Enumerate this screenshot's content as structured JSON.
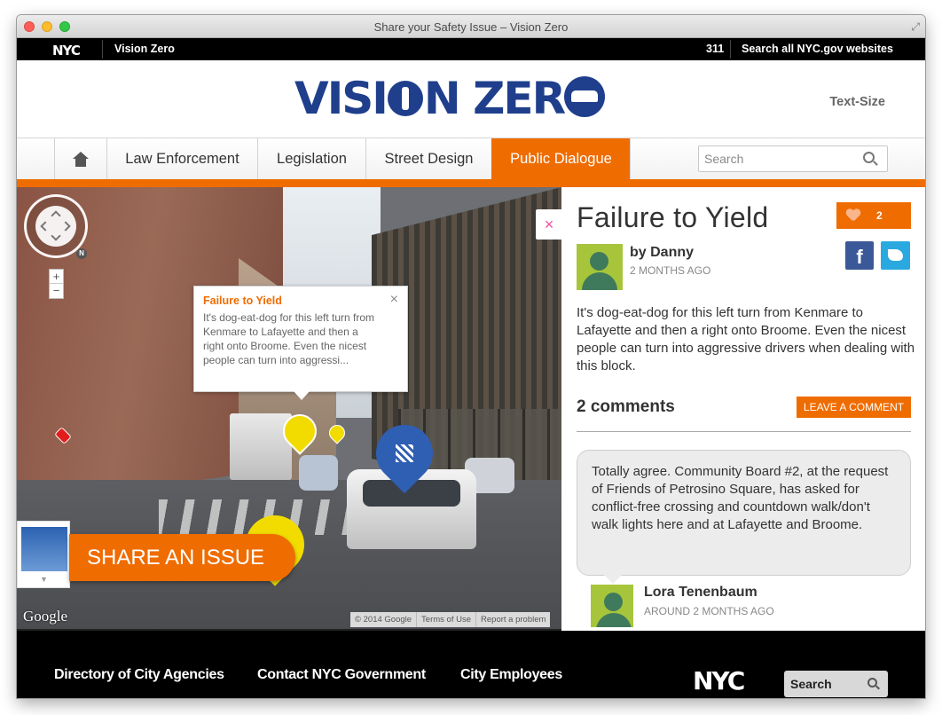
{
  "window": {
    "title": "Share your Safety Issue – Vision Zero"
  },
  "nyc_bar": {
    "logo": "NYC",
    "site": "Vision Zero",
    "link_311": "311",
    "search_all": "Search all NYC.gov websites"
  },
  "header": {
    "logo_left": "VISI",
    "logo_mid": "N ZER",
    "text_size": "Text-Size"
  },
  "nav": {
    "items": [
      {
        "label": "Law Enforcement"
      },
      {
        "label": "Legislation"
      },
      {
        "label": "Street Design"
      },
      {
        "label": "Public Dialogue",
        "active": true
      }
    ],
    "search_placeholder": "Search"
  },
  "map": {
    "callout": {
      "title": "Failure to Yield",
      "body": "It's dog-eat-dog for this left turn from Kenmare to Lafayette and then a right onto Broome. Even the nicest people can turn into aggressi..."
    },
    "share_button": "SHARE AN ISSUE",
    "google_logo": "Google",
    "attribution": [
      "© 2014 Google",
      "Terms of Use",
      "Report a problem"
    ],
    "zoom_in": "+",
    "zoom_out": "−",
    "compass_n": "N"
  },
  "issue": {
    "title": "Failure to Yield",
    "likes": "2",
    "author": "by Danny",
    "time": "2 MONTHS AGO",
    "description": "It's dog-eat-dog for this left turn from Kenmare to Lafayette and then a right onto Broome. Even the nicest people can turn into aggressive drivers when dealing with this block.",
    "comments_header": "2 comments",
    "leave_comment": "LEAVE A COMMENT",
    "facebook": "f",
    "close": "×"
  },
  "comments": [
    {
      "text": "Totally agree. Community Board #2, at the request of Friends of Petrosino Square, has asked for conflict-free crossing and countdown walk/don't walk lights here and at Lafayette and Broome.",
      "author": "Lora Tenenbaum",
      "time": "AROUND 2 MONTHS AGO"
    }
  ],
  "footer": {
    "links": [
      "Directory of City Agencies",
      "Contact NYC Government",
      "City Employees"
    ],
    "logo": "NYC",
    "search_placeholder": "Search"
  },
  "colors": {
    "accent": "#ef6c00",
    "brand_blue": "#1f3f8c",
    "facebook": "#3b5998",
    "twitter": "#2aa9e0",
    "avatar": "#a7c53a"
  }
}
